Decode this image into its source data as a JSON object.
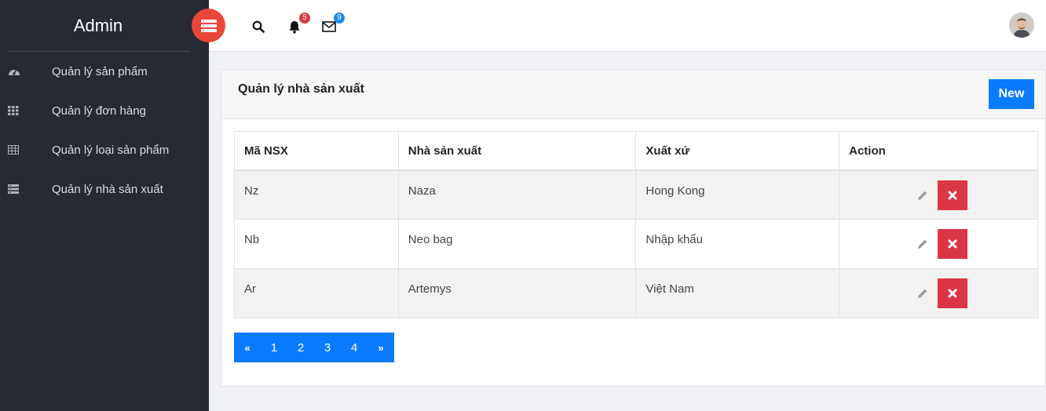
{
  "brand": {
    "title": "Admin"
  },
  "sidebar": {
    "items": [
      {
        "label": "Quản lý sản phẩm",
        "icon": "dashboard-icon"
      },
      {
        "label": "Quản lý đơn hàng",
        "icon": "grid-icon"
      },
      {
        "label": "Quản lý loại sản phẩm",
        "icon": "table-icon"
      },
      {
        "label": "Quản lý nhà sản xuất",
        "icon": "list-icon"
      }
    ]
  },
  "topbar": {
    "notifications_count": "5",
    "messages_count": "9"
  },
  "card": {
    "title": "Quản lý nhà sản xuất",
    "new_label": "New"
  },
  "table": {
    "headers": [
      "Mã NSX",
      "Nhà sản xuất",
      "Xuất xứ",
      "Action"
    ],
    "rows": [
      [
        "Nz",
        "Naza",
        "Hong Kong"
      ],
      [
        "Nb",
        "Neo bag",
        "Nhập khẩu"
      ],
      [
        "Ar",
        "Artemys",
        "Việt Nam"
      ]
    ]
  },
  "pagination": {
    "prev": "«",
    "pages": [
      "1",
      "2",
      "3",
      "4"
    ],
    "next": "»"
  },
  "colors": {
    "sidebar_bg": "#252a33",
    "toggle_bg": "#e9473a",
    "primary": "#0a7bff",
    "danger": "#dc3545"
  }
}
